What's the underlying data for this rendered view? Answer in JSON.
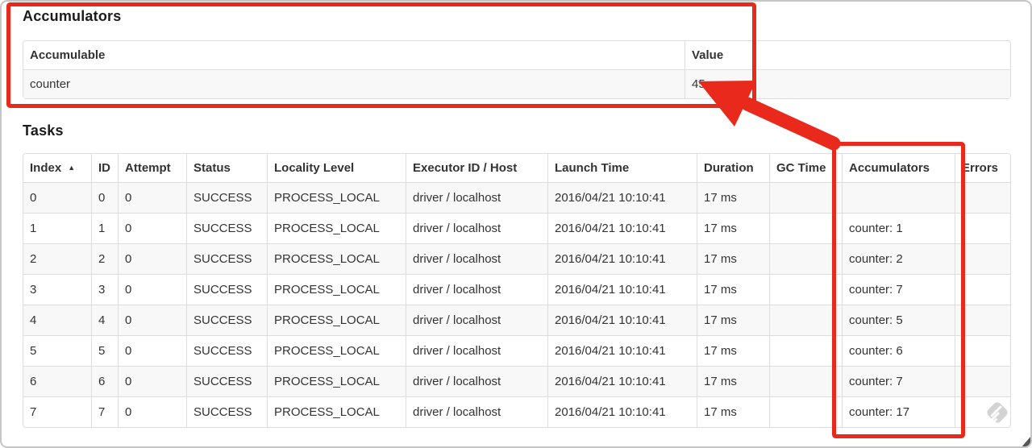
{
  "annotations": {
    "highlight_color": "#e8291c"
  },
  "accumulators": {
    "title": "Accumulators",
    "table": {
      "headers": [
        {
          "key": "accumulable",
          "label": "Accumulable"
        },
        {
          "key": "value",
          "label": "Value"
        }
      ],
      "rows": [
        [
          "counter",
          "45"
        ]
      ]
    }
  },
  "tasks": {
    "title": "Tasks",
    "table": {
      "headers": [
        {
          "key": "index",
          "label": "Index",
          "sort": "▲"
        },
        {
          "key": "id",
          "label": "ID"
        },
        {
          "key": "attempt",
          "label": "Attempt"
        },
        {
          "key": "status",
          "label": "Status"
        },
        {
          "key": "locality-level",
          "label": "Locality Level"
        },
        {
          "key": "executor-id-host",
          "label": "Executor ID / Host"
        },
        {
          "key": "launch-time",
          "label": "Launch Time"
        },
        {
          "key": "duration",
          "label": "Duration"
        },
        {
          "key": "gc-time",
          "label": "GC Time"
        },
        {
          "key": "accumulators",
          "label": "Accumulators"
        },
        {
          "key": "errors",
          "label": "Errors"
        }
      ],
      "rows": [
        [
          "0",
          "0",
          "0",
          "SUCCESS",
          "PROCESS_LOCAL",
          "driver / localhost",
          "2016/04/21 10:10:41",
          "17 ms",
          "",
          "",
          ""
        ],
        [
          "1",
          "1",
          "0",
          "SUCCESS",
          "PROCESS_LOCAL",
          "driver / localhost",
          "2016/04/21 10:10:41",
          "17 ms",
          "",
          "counter: 1",
          ""
        ],
        [
          "2",
          "2",
          "0",
          "SUCCESS",
          "PROCESS_LOCAL",
          "driver / localhost",
          "2016/04/21 10:10:41",
          "17 ms",
          "",
          "counter: 2",
          ""
        ],
        [
          "3",
          "3",
          "0",
          "SUCCESS",
          "PROCESS_LOCAL",
          "driver / localhost",
          "2016/04/21 10:10:41",
          "17 ms",
          "",
          "counter: 7",
          ""
        ],
        [
          "4",
          "4",
          "0",
          "SUCCESS",
          "PROCESS_LOCAL",
          "driver / localhost",
          "2016/04/21 10:10:41",
          "17 ms",
          "",
          "counter: 5",
          ""
        ],
        [
          "5",
          "5",
          "0",
          "SUCCESS",
          "PROCESS_LOCAL",
          "driver / localhost",
          "2016/04/21 10:10:41",
          "17 ms",
          "",
          "counter: 6",
          ""
        ],
        [
          "6",
          "6",
          "0",
          "SUCCESS",
          "PROCESS_LOCAL",
          "driver / localhost",
          "2016/04/21 10:10:41",
          "17 ms",
          "",
          "counter: 7",
          ""
        ],
        [
          "7",
          "7",
          "0",
          "SUCCESS",
          "PROCESS_LOCAL",
          "driver / localhost",
          "2016/04/21 10:10:41",
          "17 ms",
          "",
          "counter: 17",
          ""
        ]
      ]
    }
  }
}
